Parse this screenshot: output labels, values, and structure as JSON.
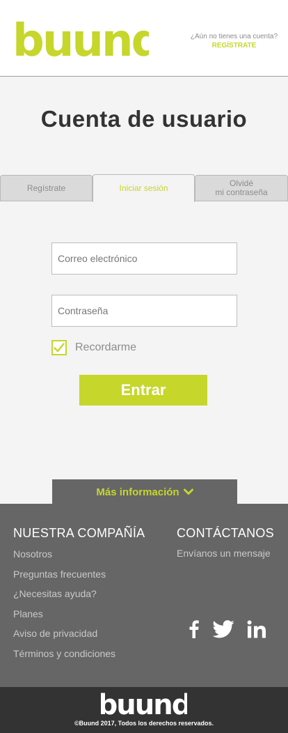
{
  "brand": {
    "name": "buund",
    "accent": "#c6d62b"
  },
  "header": {
    "prompt": "¿Aún no tienes una cuenta?",
    "signup_link": "REGÍSTRATE"
  },
  "page_title": "Cuenta de usuario",
  "tabs": [
    {
      "label": "Regístrate"
    },
    {
      "label": "Iniciar sesión",
      "active": true
    },
    {
      "line1": "Olvidé",
      "line2": "mi contraseña"
    }
  ],
  "form": {
    "email_placeholder": "Correo electrónico",
    "password_placeholder": "Contraseña",
    "remember_label": "Recordarme",
    "remember_checked": true,
    "submit_label": "Entrar"
  },
  "more_info": {
    "label": "Más información",
    "icon": "chevron-down-icon"
  },
  "footer": {
    "company_heading": "NUESTRA COMPAÑÍA",
    "company_links": [
      "Nosotros",
      "Preguntas frecuentes",
      "¿Necesitas ayuda?",
      "Planes",
      "Aviso de privacidad",
      "Términos y condiciones"
    ],
    "contact_heading": "CONTÁCTANOS",
    "contact_link": "Envíanos un mensaje",
    "social": [
      "facebook-icon",
      "twitter-icon",
      "linkedin-icon"
    ]
  },
  "bottom": {
    "copyright": "©Buund 2017, Todos los derechos reservados."
  }
}
